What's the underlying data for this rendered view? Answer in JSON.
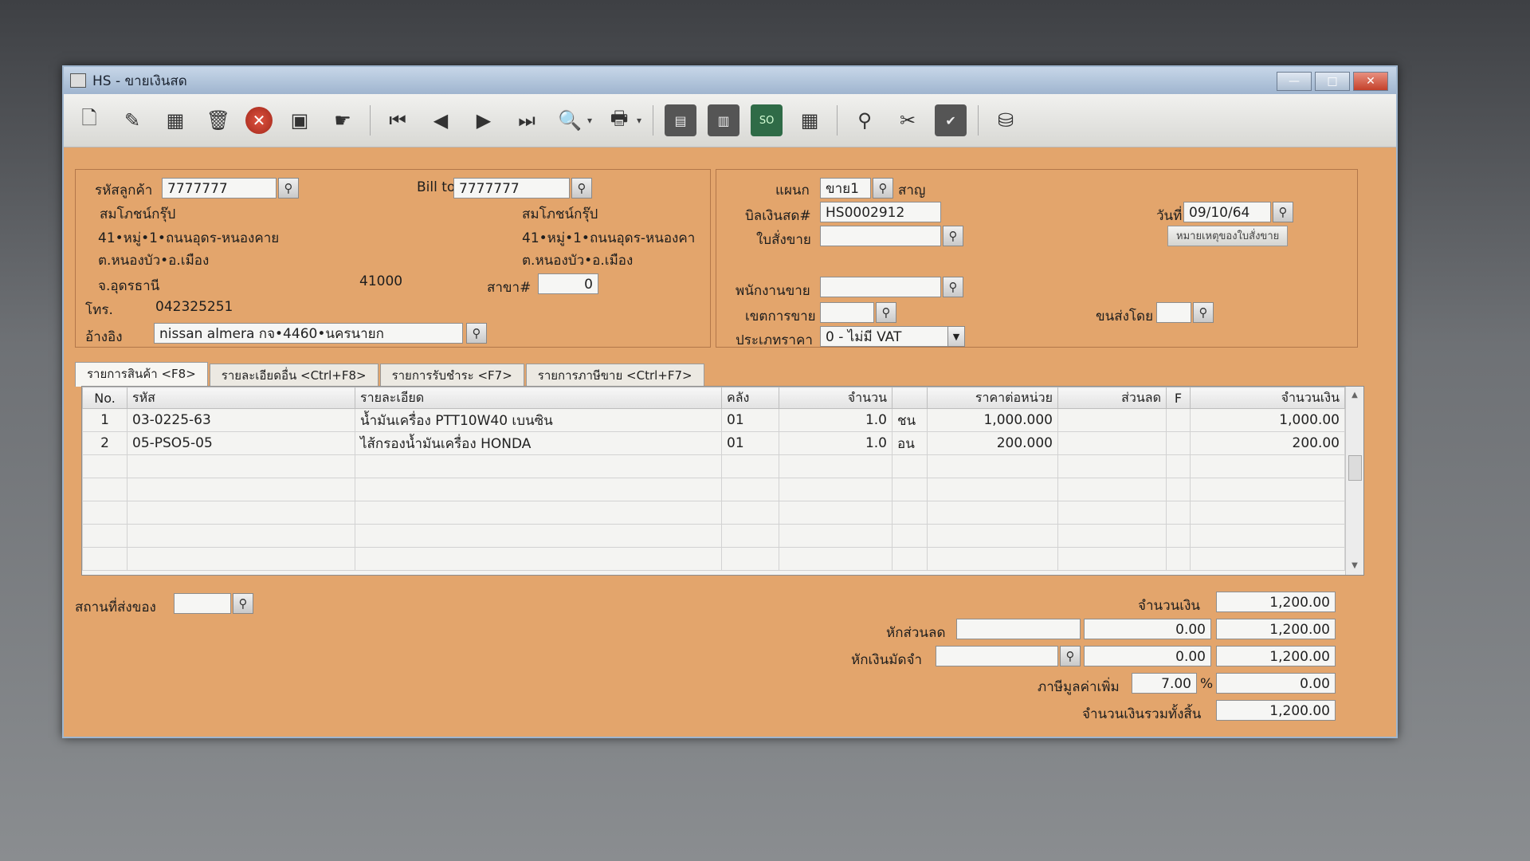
{
  "window": {
    "title": "HS - ขายเงินสด",
    "minimize": "—",
    "maximize": "□",
    "close": "✕"
  },
  "toolbar": {
    "icons": [
      "new-document-icon",
      "edit-icon",
      "delete-card-icon",
      "trash-icon",
      "cancel-icon",
      "save-icon",
      "hand-icon",
      "first-record-icon",
      "previous-record-icon",
      "next-record-icon",
      "last-record-icon",
      "search-icon",
      "printer-icon",
      "calculator-icon",
      "form-icon",
      "so-icon",
      "report-icon",
      "ok-stamp-icon",
      "tools-icon",
      "ok-icon",
      "network-icon"
    ]
  },
  "customer": {
    "code_label": "รหัสลูกค้า",
    "code_value": "7777777",
    "name": "สมโภชน์กรุ๊ป",
    "addr1": "41•หมู่•1•ถนนอุดร-หนองคาย",
    "addr2": "ต.หนองบัว•อ.เมือง",
    "province": "จ.อุดรธานี",
    "zip": "41000",
    "phone_label": "โทร.",
    "phone": "042325251",
    "ref_label": "อ้างอิง",
    "ref_value": "nissan almera กจ•4460•นครนายก"
  },
  "billto": {
    "label": "Bill to",
    "value": "7777777",
    "name": "สมโภชน์กรุ๊ป",
    "addr1": "41•หมู่•1•ถนนอุดร-หนองคา",
    "addr2": "ต.หนองบัว•อ.เมือง",
    "branch_label": "สาขา#",
    "branch_value": "0"
  },
  "doc": {
    "dept_label": "แผนก",
    "dept_value": "ขาย1",
    "dept_name": "สาญ",
    "bill_label": "บิลเงินสด#",
    "bill_value": "HS0002912",
    "order_label": "ใบสั่งขาย",
    "order_value": "",
    "date_label": "วันที่",
    "date_value": "09/10/64",
    "note_button": "หมายเหตุของใบสั่งขาย",
    "salesman_label": "พนักงานขาย",
    "salesman_value": "",
    "area_label": "เขตการขาย",
    "area_value": "",
    "ship_label": "ขนส่งโดย",
    "ship_value": "",
    "price_type_label": "ประเภทราคา",
    "price_type_value": "0 - ไม่มี VAT"
  },
  "tabs": [
    "รายการสินค้า <F8>",
    "รายละเอียดอื่น <Ctrl+F8>",
    "รายการรับชำระ <F7>",
    "รายการภาษีขาย <Ctrl+F7>"
  ],
  "grid": {
    "headers": [
      "No.",
      "รหัส",
      "รายละเอียด",
      "คลัง",
      "จำนวน",
      "",
      "ราคาต่อหน่วย",
      "ส่วนลด",
      "F",
      "จำนวนเงิน"
    ],
    "rows": [
      {
        "no": "1",
        "code": "03-0225-63",
        "desc": "น้ำมันเครื่อง PTT10W40 เบนซิน",
        "wh": "01",
        "qty": "1.0",
        "unit": "ชน",
        "price": "1,000.000",
        "disc": "",
        "f": "",
        "amount": "1,000.00"
      },
      {
        "no": "2",
        "code": "05-PSO5-05",
        "desc": "ไส้กรองน้ำมันเครื่อง HONDA",
        "wh": "01",
        "qty": "1.0",
        "unit": "อน",
        "price": "200.000",
        "disc": "",
        "f": "",
        "amount": "200.00"
      }
    ]
  },
  "footer": {
    "ship_place_label": "สถานที่ส่งของ",
    "ship_place_value": "",
    "amount_label": "จำนวนเงิน",
    "amount_value": "1,200.00",
    "discount_label": "หักส่วนลด",
    "discount_input": "",
    "discount_value": "0.00",
    "after_discount": "1,200.00",
    "deposit_label": "หักเงินมัดจำ",
    "deposit_input": "",
    "deposit_value": "0.00",
    "after_deposit": "1,200.00",
    "vat_label": "ภาษีมูลค่าเพิ่ม",
    "vat_rate": "7.00",
    "vat_pct": "%",
    "vat_value": "0.00",
    "total_label": "จำนวนเงินรวมทั้งสิ้น",
    "total_value": "1,200.00"
  }
}
